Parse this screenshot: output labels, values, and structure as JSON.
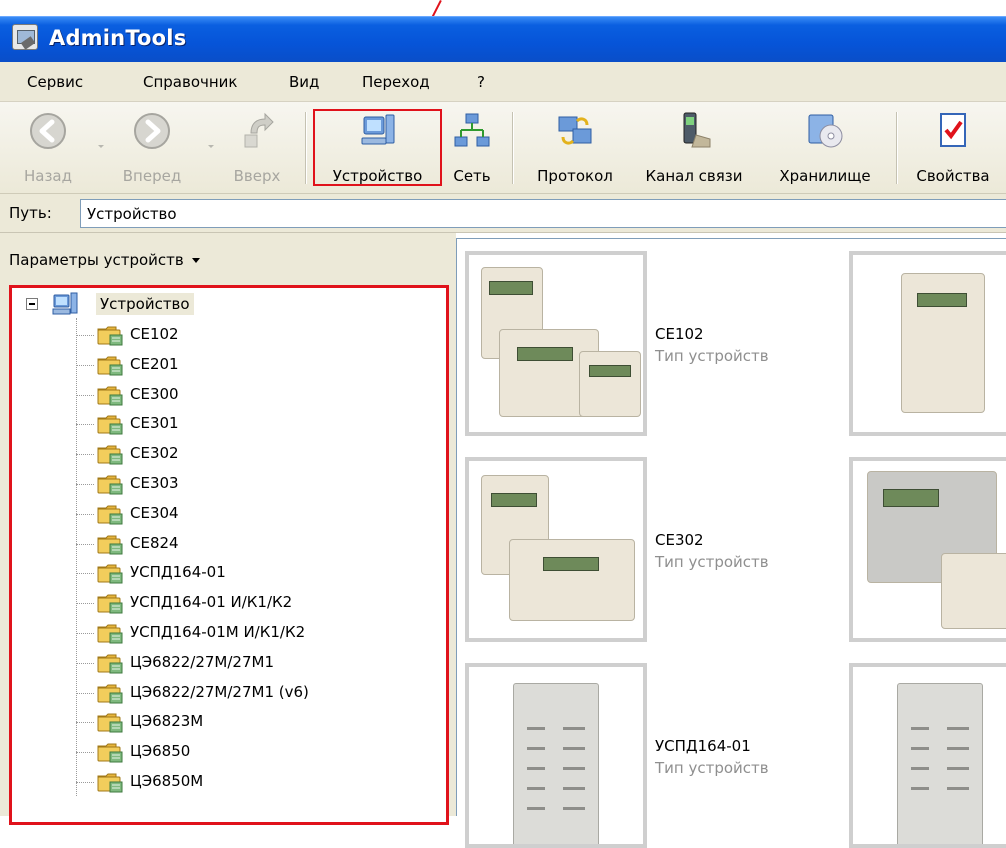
{
  "window": {
    "title": "AdminTools"
  },
  "menu": [
    "Сервис",
    "Справочник",
    "Вид",
    "Переход",
    "?"
  ],
  "toolbar": {
    "back": "Назад",
    "forward": "Вперед",
    "up": "Вверх",
    "device": "Устройство",
    "network": "Сеть",
    "protocol": "Протокол",
    "channel": "Канал связи",
    "storage": "Хранилище",
    "properties": "Свойства"
  },
  "path": {
    "label": "Путь:",
    "value": "Устройство"
  },
  "left_panel": {
    "header": "Параметры устройств",
    "root": "Устройство",
    "items": [
      "CE102",
      "CE201",
      "CE300",
      "CE301",
      "CE302",
      "CE303",
      "CE304",
      "CE824",
      "УСПД164-01",
      "УСПД164-01 И/К1/К2",
      "УСПД164-01М И/К1/К2",
      "ЦЭ6822/27М/27М1",
      "ЦЭ6822/27М/27М1 (v6)",
      "ЦЭ6823М",
      "ЦЭ6850",
      "ЦЭ6850М"
    ]
  },
  "tiles": [
    {
      "name": "CE102",
      "type": "Тип устройств"
    },
    {
      "name": "CE302",
      "type": "Тип устройств"
    },
    {
      "name": "УСПД164-01",
      "type": "Тип устройств"
    }
  ],
  "colors": {
    "titlebar": "#0654d8",
    "highlight": "#e0121b",
    "chrome": "#ece9d8"
  }
}
